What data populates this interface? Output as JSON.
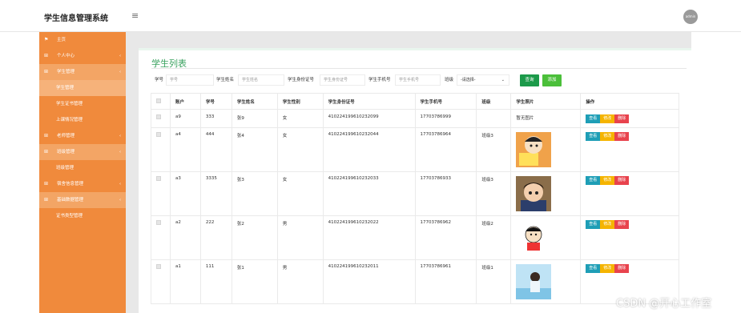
{
  "header": {
    "brand": "学生信息管理系统",
    "menu_icon": "hamburger-icon",
    "avatar_text": "admin"
  },
  "sidebar": {
    "items": [
      {
        "label": "主页",
        "icon": "flag-icon"
      },
      {
        "label": "个人中心",
        "icon": "grid-icon",
        "arrow": "‹"
      },
      {
        "label": "学生管理",
        "icon": "grid-icon",
        "arrow": "‹"
      },
      {
        "label": "学生管理"
      },
      {
        "label": "学生证书管理"
      },
      {
        "label": "上课情况管理"
      },
      {
        "label": "老师管理",
        "icon": "grid-icon",
        "arrow": "‹"
      },
      {
        "label": "班级管理",
        "icon": "grid-icon",
        "arrow": "‹"
      },
      {
        "label": "班级管理"
      },
      {
        "label": "宿舍信息管理",
        "icon": "grid-icon",
        "arrow": "‹"
      },
      {
        "label": "基础数据管理",
        "icon": "grid-icon",
        "arrow": "‹"
      },
      {
        "label": "证书类型管理"
      }
    ]
  },
  "panel": {
    "title": "学生列表"
  },
  "search": {
    "f1_label": "学号",
    "f1_placeholder": "学号",
    "f2_label": "学生姓名",
    "f2_placeholder": "学生姓名",
    "f3_label": "学生身份证号",
    "f3_placeholder": "学生身份证号",
    "f4_label": "学生手机号",
    "f4_placeholder": "学生手机号",
    "f5_label": "班级",
    "f5_value": "-请选择-",
    "query_label": "查询",
    "add_label": "添加"
  },
  "table": {
    "headers": [
      "",
      "账户",
      "学号",
      "学生姓名",
      "学生性别",
      "学生身份证号",
      "学生手机号",
      "班级",
      "学生照片",
      "操作"
    ],
    "rows": [
      {
        "account": "a9",
        "no": "333",
        "name": "张9",
        "gender": "女",
        "idcard": "410224199610232099",
        "phone": "17703786999",
        "class": "",
        "photo_text": "暂无图片",
        "photo": "none"
      },
      {
        "account": "a4",
        "no": "444",
        "name": "张4",
        "gender": "女",
        "idcard": "410224199610232044",
        "phone": "17703786964",
        "class": "班级3",
        "photo_text": "",
        "photo": "cartoon-1"
      },
      {
        "account": "a3",
        "no": "3335",
        "name": "张3",
        "gender": "女",
        "idcard": "410224199610232033",
        "phone": "17703786933",
        "class": "班级3",
        "photo_text": "",
        "photo": "cartoon-2"
      },
      {
        "account": "a2",
        "no": "222",
        "name": "张2",
        "gender": "男",
        "idcard": "410224199610232022",
        "phone": "17703786962",
        "class": "班级2",
        "photo_text": "",
        "photo": "cartoon-3"
      },
      {
        "account": "a1",
        "no": "111",
        "name": "张1",
        "gender": "男",
        "idcard": "410224199610232011",
        "phone": "17703786961",
        "class": "班级1",
        "photo_text": "",
        "photo": "cartoon-4"
      }
    ],
    "op_view": "查看",
    "op_edit": "修改",
    "op_del": "删除"
  },
  "watermark": "CSDN @开心工作室",
  "colors": {
    "sidebar": "#f08a3c",
    "accent_green": "#1c9a4a",
    "view": "#1e9eb6",
    "edit": "#f5b400",
    "delete": "#e8434d"
  }
}
